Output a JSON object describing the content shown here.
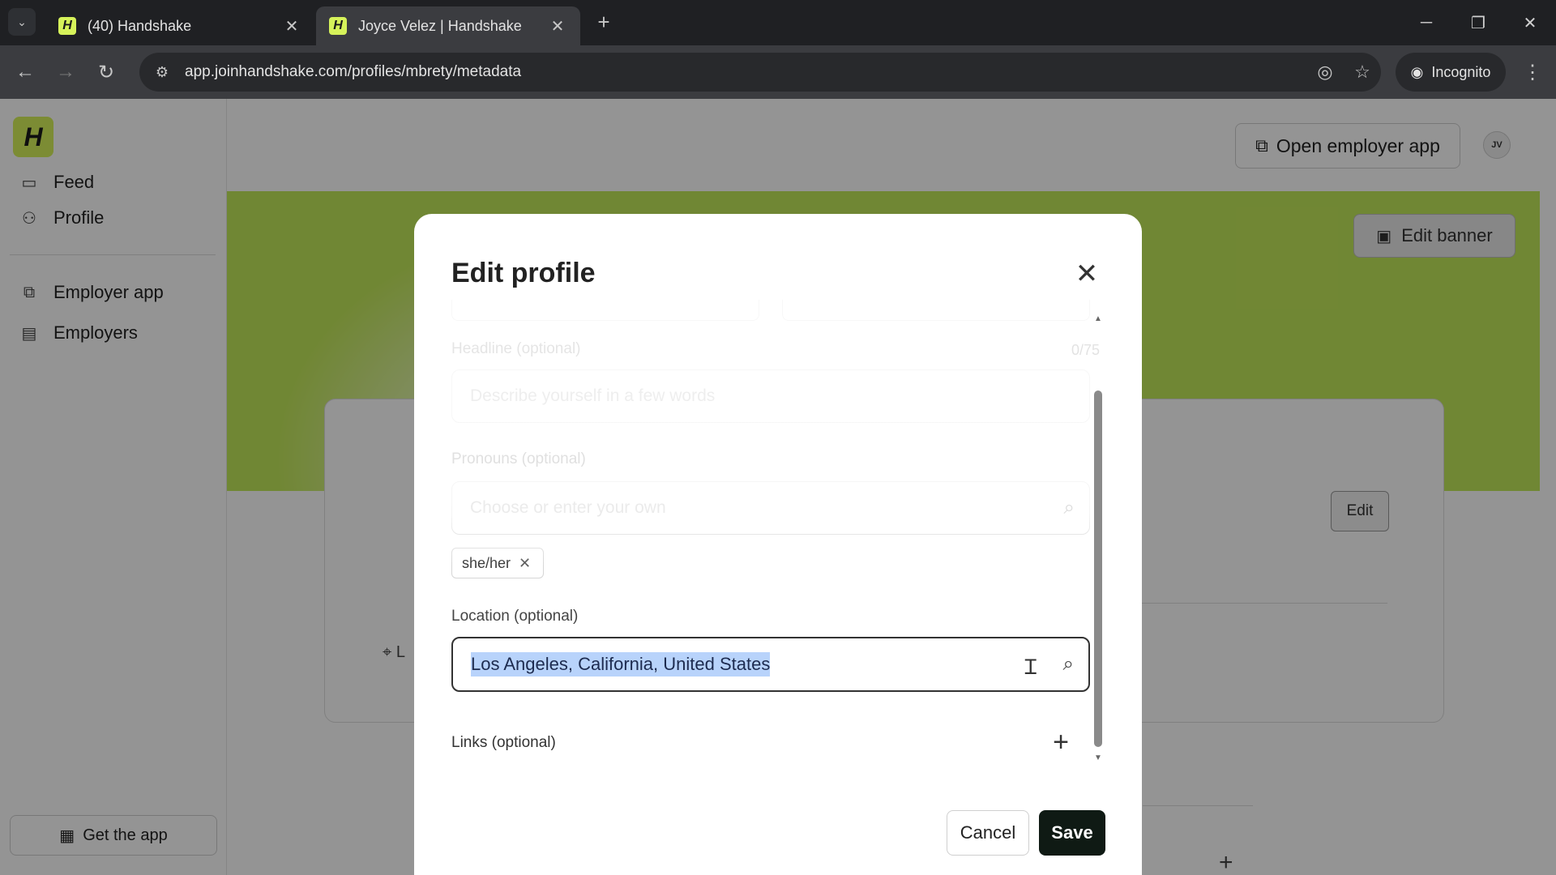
{
  "browser": {
    "tabs": [
      {
        "title": "(40) Handshake",
        "favicon": "H"
      },
      {
        "title": "Joyce Velez | Handshake",
        "favicon": "H"
      }
    ],
    "url": "app.joinhandshake.com/profiles/mbrety/metadata",
    "incognito_label": "Incognito"
  },
  "sidebar": {
    "logo": "H",
    "items": [
      {
        "label": "Feed",
        "icon": "feed-icon"
      },
      {
        "label": "Profile",
        "icon": "person-icon"
      },
      {
        "label": "Employer app",
        "icon": "external-link-icon"
      },
      {
        "label": "Employers",
        "icon": "building-icon"
      }
    ],
    "get_app": "Get the app"
  },
  "header": {
    "open_employer_app": "Open employer app",
    "avatar_initials": "JV"
  },
  "banner": {
    "edit_banner": "Edit banner"
  },
  "card": {
    "edit_label": "Edit",
    "location_snippet": "L"
  },
  "modal": {
    "title": "Edit profile",
    "headline_label": "Headline (optional)",
    "headline_counter": "0/75",
    "headline_placeholder": "Describe yourself in a few words",
    "pronouns_label": "Pronouns (optional)",
    "pronouns_placeholder": "Choose or enter your own",
    "pronoun_chip": "she/her",
    "location_label": "Location (optional)",
    "location_value": "Los Angeles, California, United States",
    "links_label": "Links (optional)",
    "cancel": "Cancel",
    "save": "Save"
  },
  "colors": {
    "brand": "#d6f25a",
    "banner": "#c2e85a",
    "save_button": "#0f1a14",
    "selection": "#b8d3fb"
  }
}
